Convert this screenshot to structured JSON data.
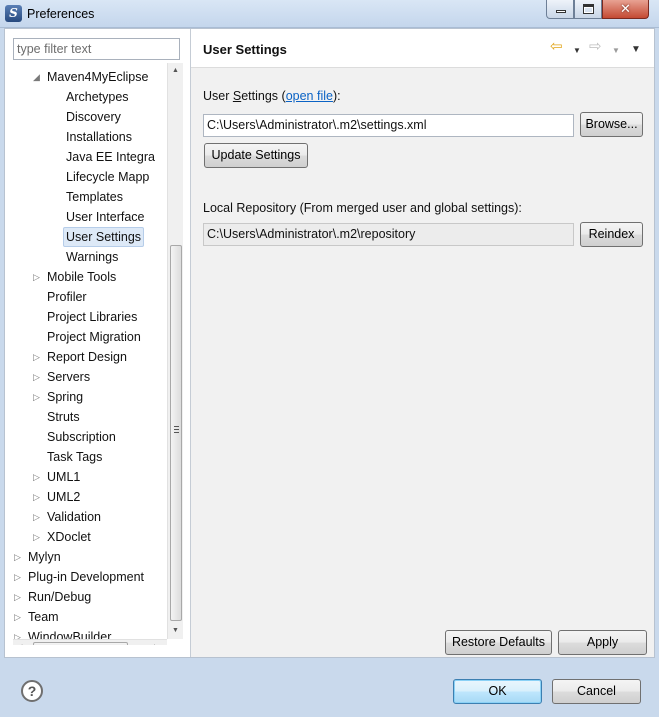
{
  "window": {
    "title": "Preferences"
  },
  "filter": {
    "placeholder": "type filter text"
  },
  "tree": {
    "items": [
      {
        "label": "Maven4MyEclipse",
        "indent": 2,
        "toggle": "expanded"
      },
      {
        "label": "Archetypes",
        "indent": 3,
        "toggle": "none"
      },
      {
        "label": "Discovery",
        "indent": 3,
        "toggle": "none"
      },
      {
        "label": "Installations",
        "indent": 3,
        "toggle": "none"
      },
      {
        "label": "Java EE Integra",
        "indent": 3,
        "toggle": "none"
      },
      {
        "label": "Lifecycle Mapp",
        "indent": 3,
        "toggle": "none"
      },
      {
        "label": "Templates",
        "indent": 3,
        "toggle": "none"
      },
      {
        "label": "User Interface",
        "indent": 3,
        "toggle": "none"
      },
      {
        "label": "User Settings",
        "indent": 3,
        "toggle": "none",
        "selected": true
      },
      {
        "label": "Warnings",
        "indent": 3,
        "toggle": "none"
      },
      {
        "label": "Mobile Tools",
        "indent": 2,
        "toggle": "collapsed"
      },
      {
        "label": "Profiler",
        "indent": 2,
        "toggle": "none"
      },
      {
        "label": "Project Libraries",
        "indent": 2,
        "toggle": "none"
      },
      {
        "label": "Project Migration",
        "indent": 2,
        "toggle": "none"
      },
      {
        "label": "Report Design",
        "indent": 2,
        "toggle": "collapsed"
      },
      {
        "label": "Servers",
        "indent": 2,
        "toggle": "collapsed"
      },
      {
        "label": "Spring",
        "indent": 2,
        "toggle": "collapsed"
      },
      {
        "label": "Struts",
        "indent": 2,
        "toggle": "none"
      },
      {
        "label": "Subscription",
        "indent": 2,
        "toggle": "none"
      },
      {
        "label": "Task Tags",
        "indent": 2,
        "toggle": "none"
      },
      {
        "label": "UML1",
        "indent": 2,
        "toggle": "collapsed"
      },
      {
        "label": "UML2",
        "indent": 2,
        "toggle": "collapsed"
      },
      {
        "label": "Validation",
        "indent": 2,
        "toggle": "collapsed"
      },
      {
        "label": "XDoclet",
        "indent": 2,
        "toggle": "collapsed"
      },
      {
        "label": "Mylyn",
        "indent": 1,
        "toggle": "collapsed"
      },
      {
        "label": "Plug-in Development",
        "indent": 1,
        "toggle": "collapsed"
      },
      {
        "label": "Run/Debug",
        "indent": 1,
        "toggle": "collapsed"
      },
      {
        "label": "Team",
        "indent": 1,
        "toggle": "collapsed"
      },
      {
        "label": "WindowBuilder",
        "indent": 1,
        "toggle": "collapsed"
      }
    ]
  },
  "page": {
    "title": "User Settings",
    "user_settings_prefix": "User ",
    "user_settings_mnemonic": "S",
    "user_settings_rest": "ettings (",
    "open_file_link": "open file",
    "user_settings_suffix": "):",
    "user_settings_path": "C:\\Users\\Administrator\\.m2\\settings.xml",
    "browse_button": "Browse...",
    "update_button": "Update Settings",
    "local_repo_label": "Local Repository (From merged user and global settings):",
    "local_repo_path": "C:\\Users\\Administrator\\.m2\\repository",
    "reindex_button": "Reindex",
    "restore_defaults_button": "Restore Defaults",
    "apply_button": "Apply"
  },
  "footer": {
    "help_glyph": "?",
    "ok_button": "OK",
    "cancel_button": "Cancel"
  },
  "icons": {
    "back": "back-arrow-icon",
    "forward": "forward-arrow-icon",
    "menu": "view-menu-icon",
    "help": "help-icon"
  },
  "colors": {
    "selection": "#dde9f7",
    "link": "#0b63c5",
    "back_arrow": "#e2a51a"
  }
}
